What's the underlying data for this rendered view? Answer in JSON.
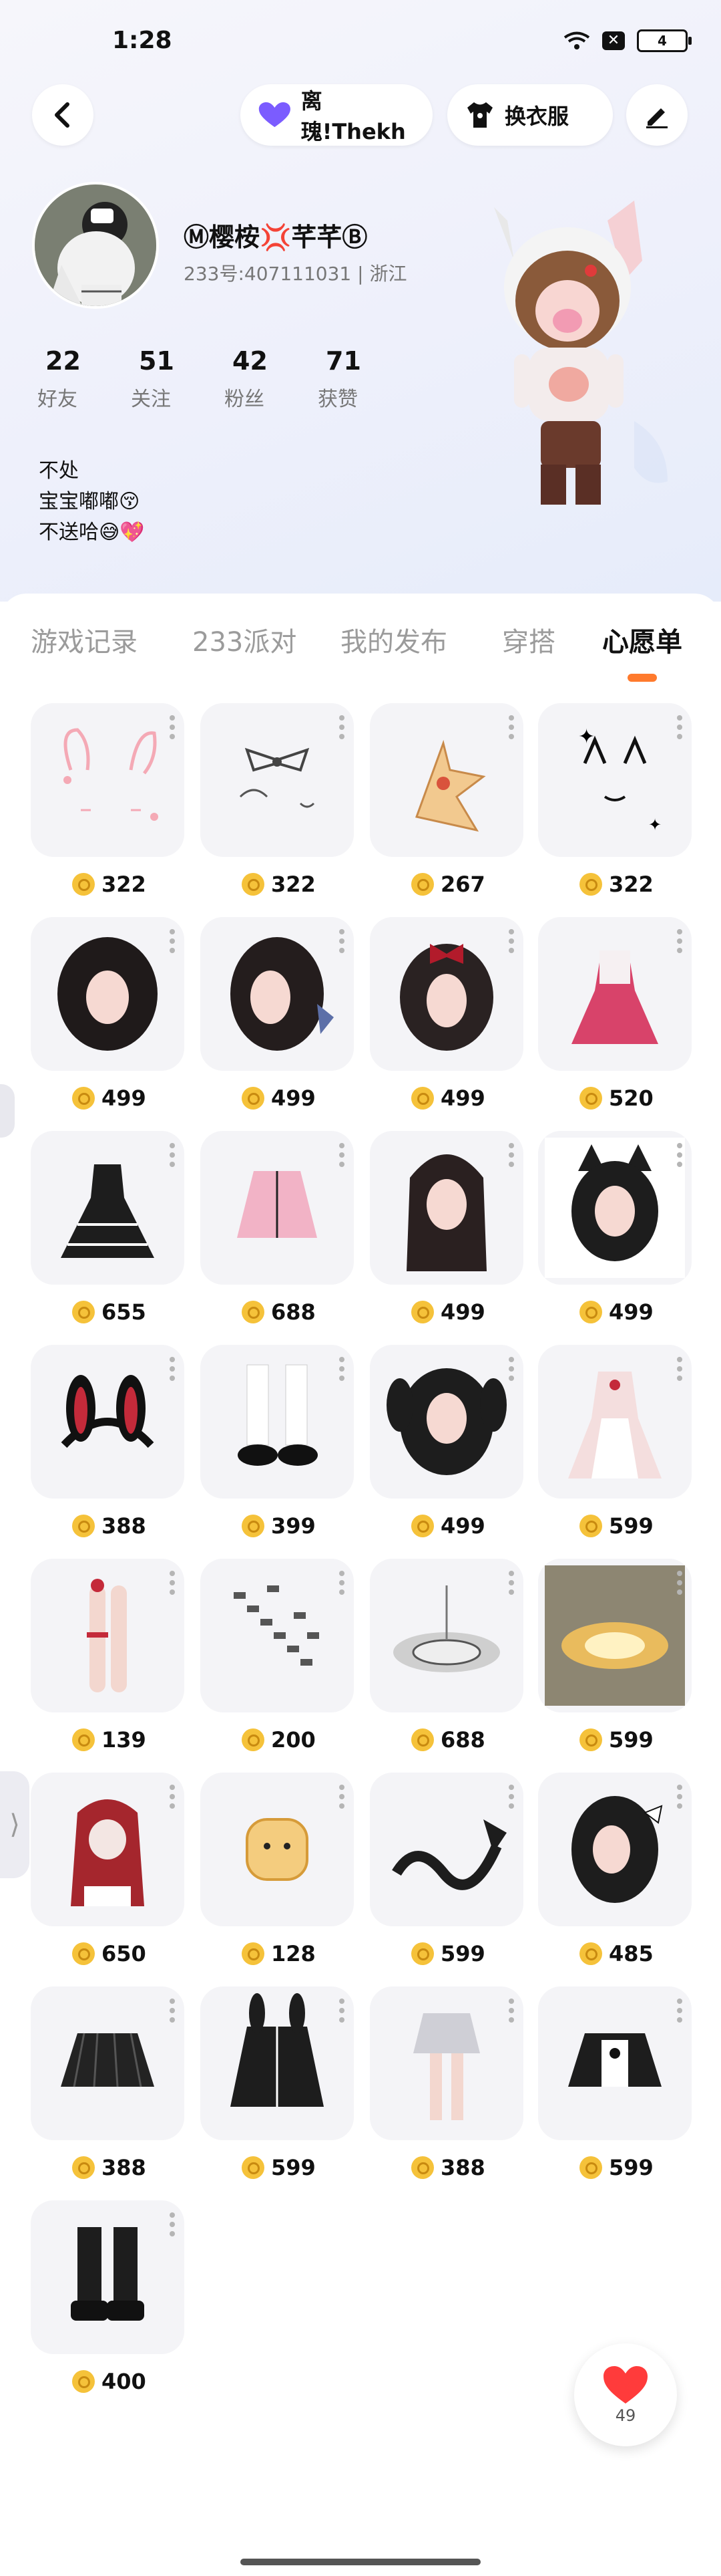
{
  "status": {
    "time": "1:28",
    "battery": "4"
  },
  "header": {
    "pet_label": "离瑰!Thekh",
    "outfit_label": "换衣服"
  },
  "profile": {
    "name": "Ⓜ樱桉💢芊芊Ⓑ",
    "uid": "233号:407111031 | 浙江",
    "stats": [
      {
        "num": "22",
        "label": "好友"
      },
      {
        "num": "51",
        "label": "关注"
      },
      {
        "num": "42",
        "label": "粉丝"
      },
      {
        "num": "71",
        "label": "获赞"
      }
    ],
    "bio": [
      "不处",
      "宝宝嘟嘟😚",
      "不送哈😅💖"
    ]
  },
  "tabs": [
    "游戏记录",
    "233派对",
    "我的发布",
    "穿搭",
    "心愿单"
  ],
  "active_tab": 4,
  "items": [
    {
      "price": "322",
      "icon": "bunny-ears-face-icon"
    },
    {
      "price": "322",
      "icon": "bow-sketch-icon"
    },
    {
      "price": "267",
      "icon": "star-pet-icon"
    },
    {
      "price": "322",
      "icon": "cat-face-icon"
    },
    {
      "price": "499",
      "icon": "dark-hair-icon"
    },
    {
      "price": "499",
      "icon": "dark-hair-ribbon-icon"
    },
    {
      "price": "499",
      "icon": "hair-red-bow-icon"
    },
    {
      "price": "520",
      "icon": "pink-dress-icon"
    },
    {
      "price": "655",
      "icon": "black-dress-icon"
    },
    {
      "price": "688",
      "icon": "pink-jacket-icon"
    },
    {
      "price": "499",
      "icon": "long-hair-icon"
    },
    {
      "price": "499",
      "icon": "cat-ears-hair-icon"
    },
    {
      "price": "388",
      "icon": "bunny-headband-icon"
    },
    {
      "price": "399",
      "icon": "shoes-socks-icon"
    },
    {
      "price": "499",
      "icon": "twin-tails-icon"
    },
    {
      "price": "599",
      "icon": "maid-dress-icon"
    },
    {
      "price": "139",
      "icon": "legs-garter-icon"
    },
    {
      "price": "200",
      "icon": "chain-trail-icon"
    },
    {
      "price": "688",
      "icon": "platform-halo-icon"
    },
    {
      "price": "599",
      "icon": "golden-glow-icon"
    },
    {
      "price": "650",
      "icon": "red-hood-icon"
    },
    {
      "price": "128",
      "icon": "toast-pet-icon"
    },
    {
      "price": "599",
      "icon": "black-dragon-icon"
    },
    {
      "price": "485",
      "icon": "bow-hair-icon"
    },
    {
      "price": "388",
      "icon": "pleated-skirt-icon"
    },
    {
      "price": "599",
      "icon": "bunny-hoodie-icon"
    },
    {
      "price": "388",
      "icon": "skirt-legs-icon"
    },
    {
      "price": "599",
      "icon": "cropped-jacket-icon"
    },
    {
      "price": "400",
      "icon": "platform-boots-icon"
    }
  ],
  "like": {
    "count": "49"
  },
  "colors": {
    "accent": "#ff7a2d",
    "coin": "#f5c23a",
    "heart": "#ff3b3b",
    "pet_heart": "#7b5cff"
  }
}
